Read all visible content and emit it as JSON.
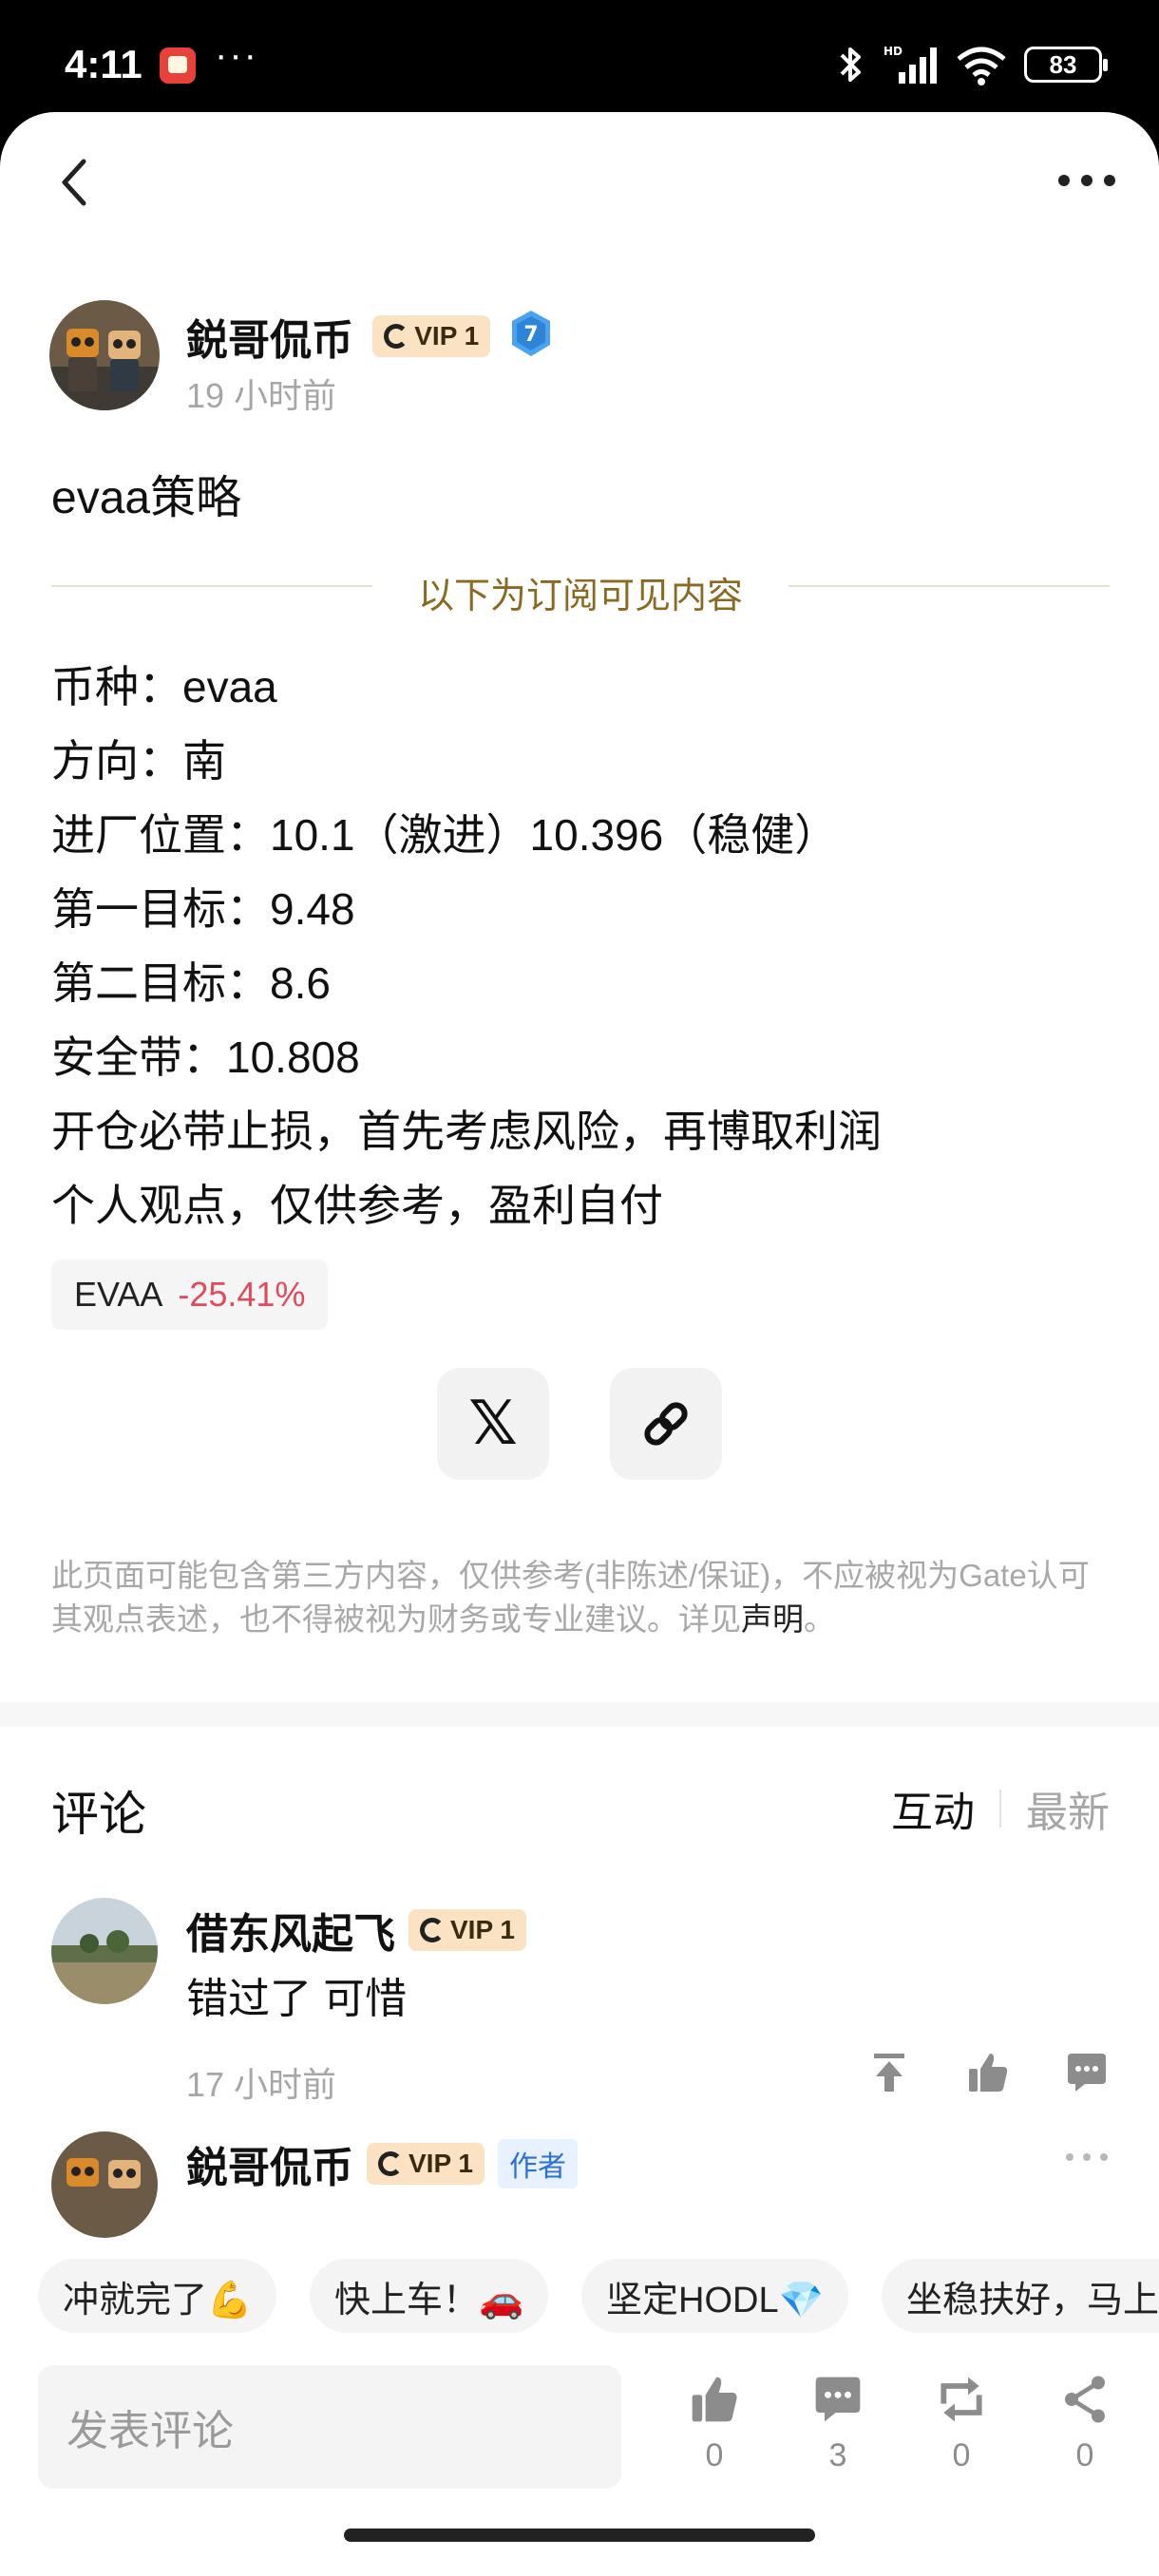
{
  "status_bar": {
    "time": "4:11",
    "more": "···",
    "battery": "83"
  },
  "nav": {
    "back": "back",
    "more": "more"
  },
  "author": {
    "name": "鋭哥侃币",
    "vip": "VIP 1",
    "level": "7",
    "time": "19 小时前"
  },
  "post": {
    "title": "evaa策略",
    "divider": "以下为订阅可见内容",
    "lines": [
      "币种：evaa",
      "方向：南",
      "进厂位置：10.1（激进）10.396（稳健）",
      "第一目标：9.48",
      "第二目标：8.6",
      "安全带：10.808",
      "开仓必带止损，首先考虑风险，再博取利润",
      "个人观点，仅供参考，盈利自付"
    ],
    "coin": {
      "name": "EVAA",
      "change": "-25.41%"
    }
  },
  "disclaimer": {
    "text": "此页面可能包含第三方内容，仅供参考(非陈述/保证)，不应被视为Gate认可其观点表述，也不得被视为财务或专业建议。详见",
    "link": "声明",
    "end": "。"
  },
  "comments": {
    "title": "评论",
    "sort_active": "互动",
    "sort_other": "最新",
    "items": [
      {
        "name": "借东风起飞",
        "vip": "VIP 1",
        "text": "错过了 可惜",
        "time": "17 小时前"
      },
      {
        "name": "鋭哥侃币",
        "vip": "VIP 1",
        "tag": "作者"
      }
    ]
  },
  "quick_replies": [
    "冲就完了💪",
    "快上车！🚗",
    "坚定HODL💎",
    "坐稳扶好，马上起飞"
  ],
  "bottom_bar": {
    "placeholder": "发表评论",
    "likes": "0",
    "comments": "3",
    "reposts": "0",
    "shares": "0"
  },
  "colors": {
    "accent_gold": "#8a6a22",
    "down_red": "#e14a5a",
    "vip_bg": "#fbe2c2",
    "author_tag": "#2c6fd8"
  }
}
